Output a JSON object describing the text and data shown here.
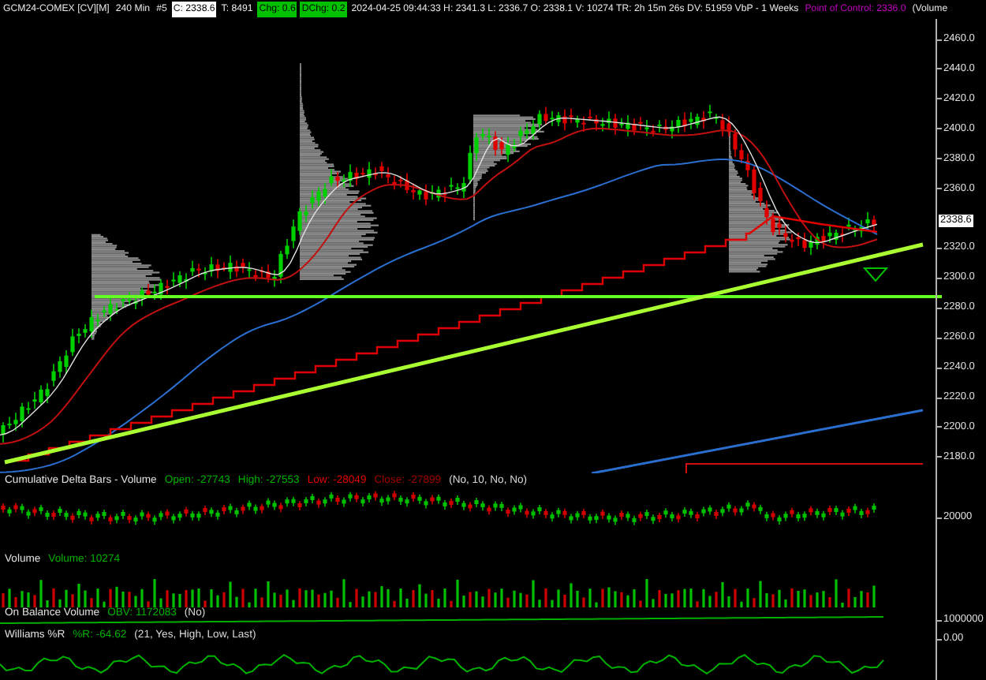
{
  "header": [
    {
      "text": "GCM24-COMEX [CV][M]",
      "kind": "plain"
    },
    {
      "text": "240 Min",
      "kind": "plain"
    },
    {
      "text": "#5",
      "kind": "plain"
    },
    {
      "text": "C: 2338.6",
      "kind": "boxed"
    },
    {
      "text": "T: 8491",
      "kind": "plain"
    },
    {
      "text": "Chg: 0.6",
      "kind": "green"
    },
    {
      "text": "DChg: 0.2",
      "kind": "green"
    },
    {
      "text": "2024-04-25 09:44:33 H: 2341.3 L: 2336.7 O: 2338.1 V: 10274 TR: 2h 15m 26s DV: 51959 VbP - 1 Weeks",
      "kind": "plain"
    },
    {
      "text": "Point of Control: 2336.0",
      "kind": "accent"
    },
    {
      "text": "(Volume",
      "kind": "plain"
    }
  ],
  "price_axis": {
    "labels": [
      {
        "text": "2460.0",
        "kind": "tick"
      },
      {
        "text": "2440.0",
        "kind": "tick"
      },
      {
        "text": "2420.0",
        "kind": "tick"
      },
      {
        "text": "2400.0",
        "kind": "tick"
      },
      {
        "text": "2380.0",
        "kind": "tick"
      },
      {
        "text": "2360.0",
        "kind": "tick"
      },
      {
        "text": "2338.6",
        "kind": "current"
      },
      {
        "text": "2320.0",
        "kind": "tick"
      },
      {
        "text": "2300.0",
        "kind": "tick"
      },
      {
        "text": "2280.0",
        "kind": "tick"
      },
      {
        "text": "2260.0",
        "kind": "tick"
      },
      {
        "text": "2240.0",
        "kind": "tick"
      },
      {
        "text": "2220.0",
        "kind": "tick"
      },
      {
        "text": "2200.0",
        "kind": "tick"
      },
      {
        "text": "2180.0",
        "kind": "tick"
      }
    ]
  },
  "panels": [
    {
      "kind": "delta",
      "title": "Cumulative Delta Bars - Volume",
      "fields": [
        {
          "text": "Open: -27743",
          "color": "#00b000"
        },
        {
          "text": "High: -27553",
          "color": "#00b000"
        },
        {
          "text": "Low: -28049",
          "color": "#e00000"
        },
        {
          "text": "Close: -27899",
          "color": "#a00000"
        },
        {
          "text": "(No, 10, No, No)",
          "color": "#d8d8d8"
        }
      ],
      "axis": [
        "20000"
      ]
    },
    {
      "kind": "volume",
      "title": "Volume",
      "fields": [
        {
          "text": "Volume: 10274",
          "color": "#00b000"
        }
      ]
    },
    {
      "kind": "obv",
      "title": "On Balance Volume",
      "fields": [
        {
          "text": "OBV: 1172083",
          "color": "#00b000"
        },
        {
          "text": "(No)",
          "color": "#d8d8d8"
        }
      ],
      "axis": [
        "1000000"
      ]
    },
    {
      "kind": "williams",
      "title": "Williams %R",
      "fields": [
        {
          "text": "%R: -64.62",
          "color": "#00b000"
        },
        {
          "text": "(21, Yes, High, Low, Last)",
          "color": "#d8d8d8"
        }
      ],
      "axis": [
        "0.00"
      ]
    }
  ]
}
